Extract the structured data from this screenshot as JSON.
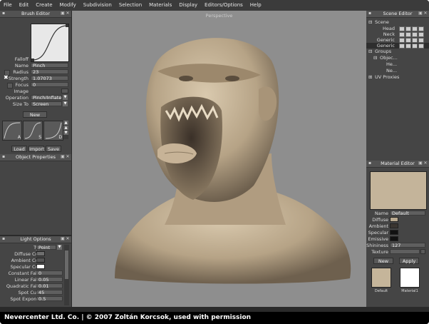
{
  "menu": [
    "File",
    "Edit",
    "Create",
    "Modify",
    "Subdivision",
    "Selection",
    "Materials",
    "Display",
    "Editors/Options",
    "Help"
  ],
  "brush_editor": {
    "title": "Brush Editor",
    "falloff_label": "Falloff",
    "name_label": "Name",
    "name_value": "Pinch",
    "radius_label": "Radius",
    "radius_value": "23",
    "strength_label": "Strength",
    "strength_value": "1.07073",
    "focus_label": "Focus",
    "focus_value": "0",
    "image_label": "Image",
    "operation_label": "Operation",
    "operation_value": "Pinch/Inflate",
    "size_to_label": "Size To",
    "size_to_value": "Screen",
    "new_button": "New",
    "preset_labels": [
      "A",
      "S",
      "D"
    ],
    "load_button": "Load",
    "import_button": "Import",
    "save_button": "Save"
  },
  "object_properties": {
    "title": "Object Properties"
  },
  "light_options": {
    "title": "Light Options",
    "fields": [
      {
        "label": "Type",
        "value": "Point",
        "kind": "drop"
      },
      {
        "label": "Diffuse Color",
        "value": "",
        "kind": "color",
        "color": "#6e6e6e"
      },
      {
        "label": "Ambient Color",
        "value": "",
        "kind": "color",
        "color": "#555555"
      },
      {
        "label": "Specular Color",
        "value": "",
        "kind": "color",
        "color": "#ffffff"
      },
      {
        "label": "Constant Falloff",
        "value": "0",
        "kind": "text"
      },
      {
        "label": "Linear Falloff",
        "value": "0.05",
        "kind": "text"
      },
      {
        "label": "Quadratic Falloff",
        "value": "0.01",
        "kind": "text"
      },
      {
        "label": "Spot Cutoff",
        "value": "45",
        "kind": "text"
      },
      {
        "label": "Spot Exponent",
        "value": "0.5",
        "kind": "text"
      }
    ]
  },
  "viewport": {
    "title": "Perspective"
  },
  "scene_editor": {
    "title": "Scene Editor",
    "root": "Scene",
    "items": [
      "Head",
      "Neck",
      "Generic",
      "Generic"
    ],
    "groups_label": "Groups",
    "group_object": "Objec...",
    "group_children": [
      "He...",
      "Ne..."
    ],
    "uv_label": "UV Proxies"
  },
  "material_editor": {
    "title": "Material Editor",
    "name_label": "Name",
    "name_value": "Default",
    "diffuse_label": "Diffuse",
    "ambient_label": "Ambient",
    "specular_label": "Specular",
    "emissive_label": "Emissive",
    "shininess_label": "Shininess",
    "shininess_value": "127",
    "texture_label": "Texture",
    "new_button": "New",
    "apply_button": "Apply",
    "materials": [
      {
        "name": "Default",
        "color": "#c5b59a"
      },
      {
        "name": "Material1",
        "color": "#ffffff"
      }
    ],
    "colors": {
      "preview": "#c4b49a",
      "diffuse": "#b9a98f",
      "ambient": "#3a3530",
      "specular": "#111111",
      "emissive": "#111111"
    }
  },
  "status": "Nevercenter Ltd. Co. | © 2007 Zoltán Korcsok, used with permission"
}
